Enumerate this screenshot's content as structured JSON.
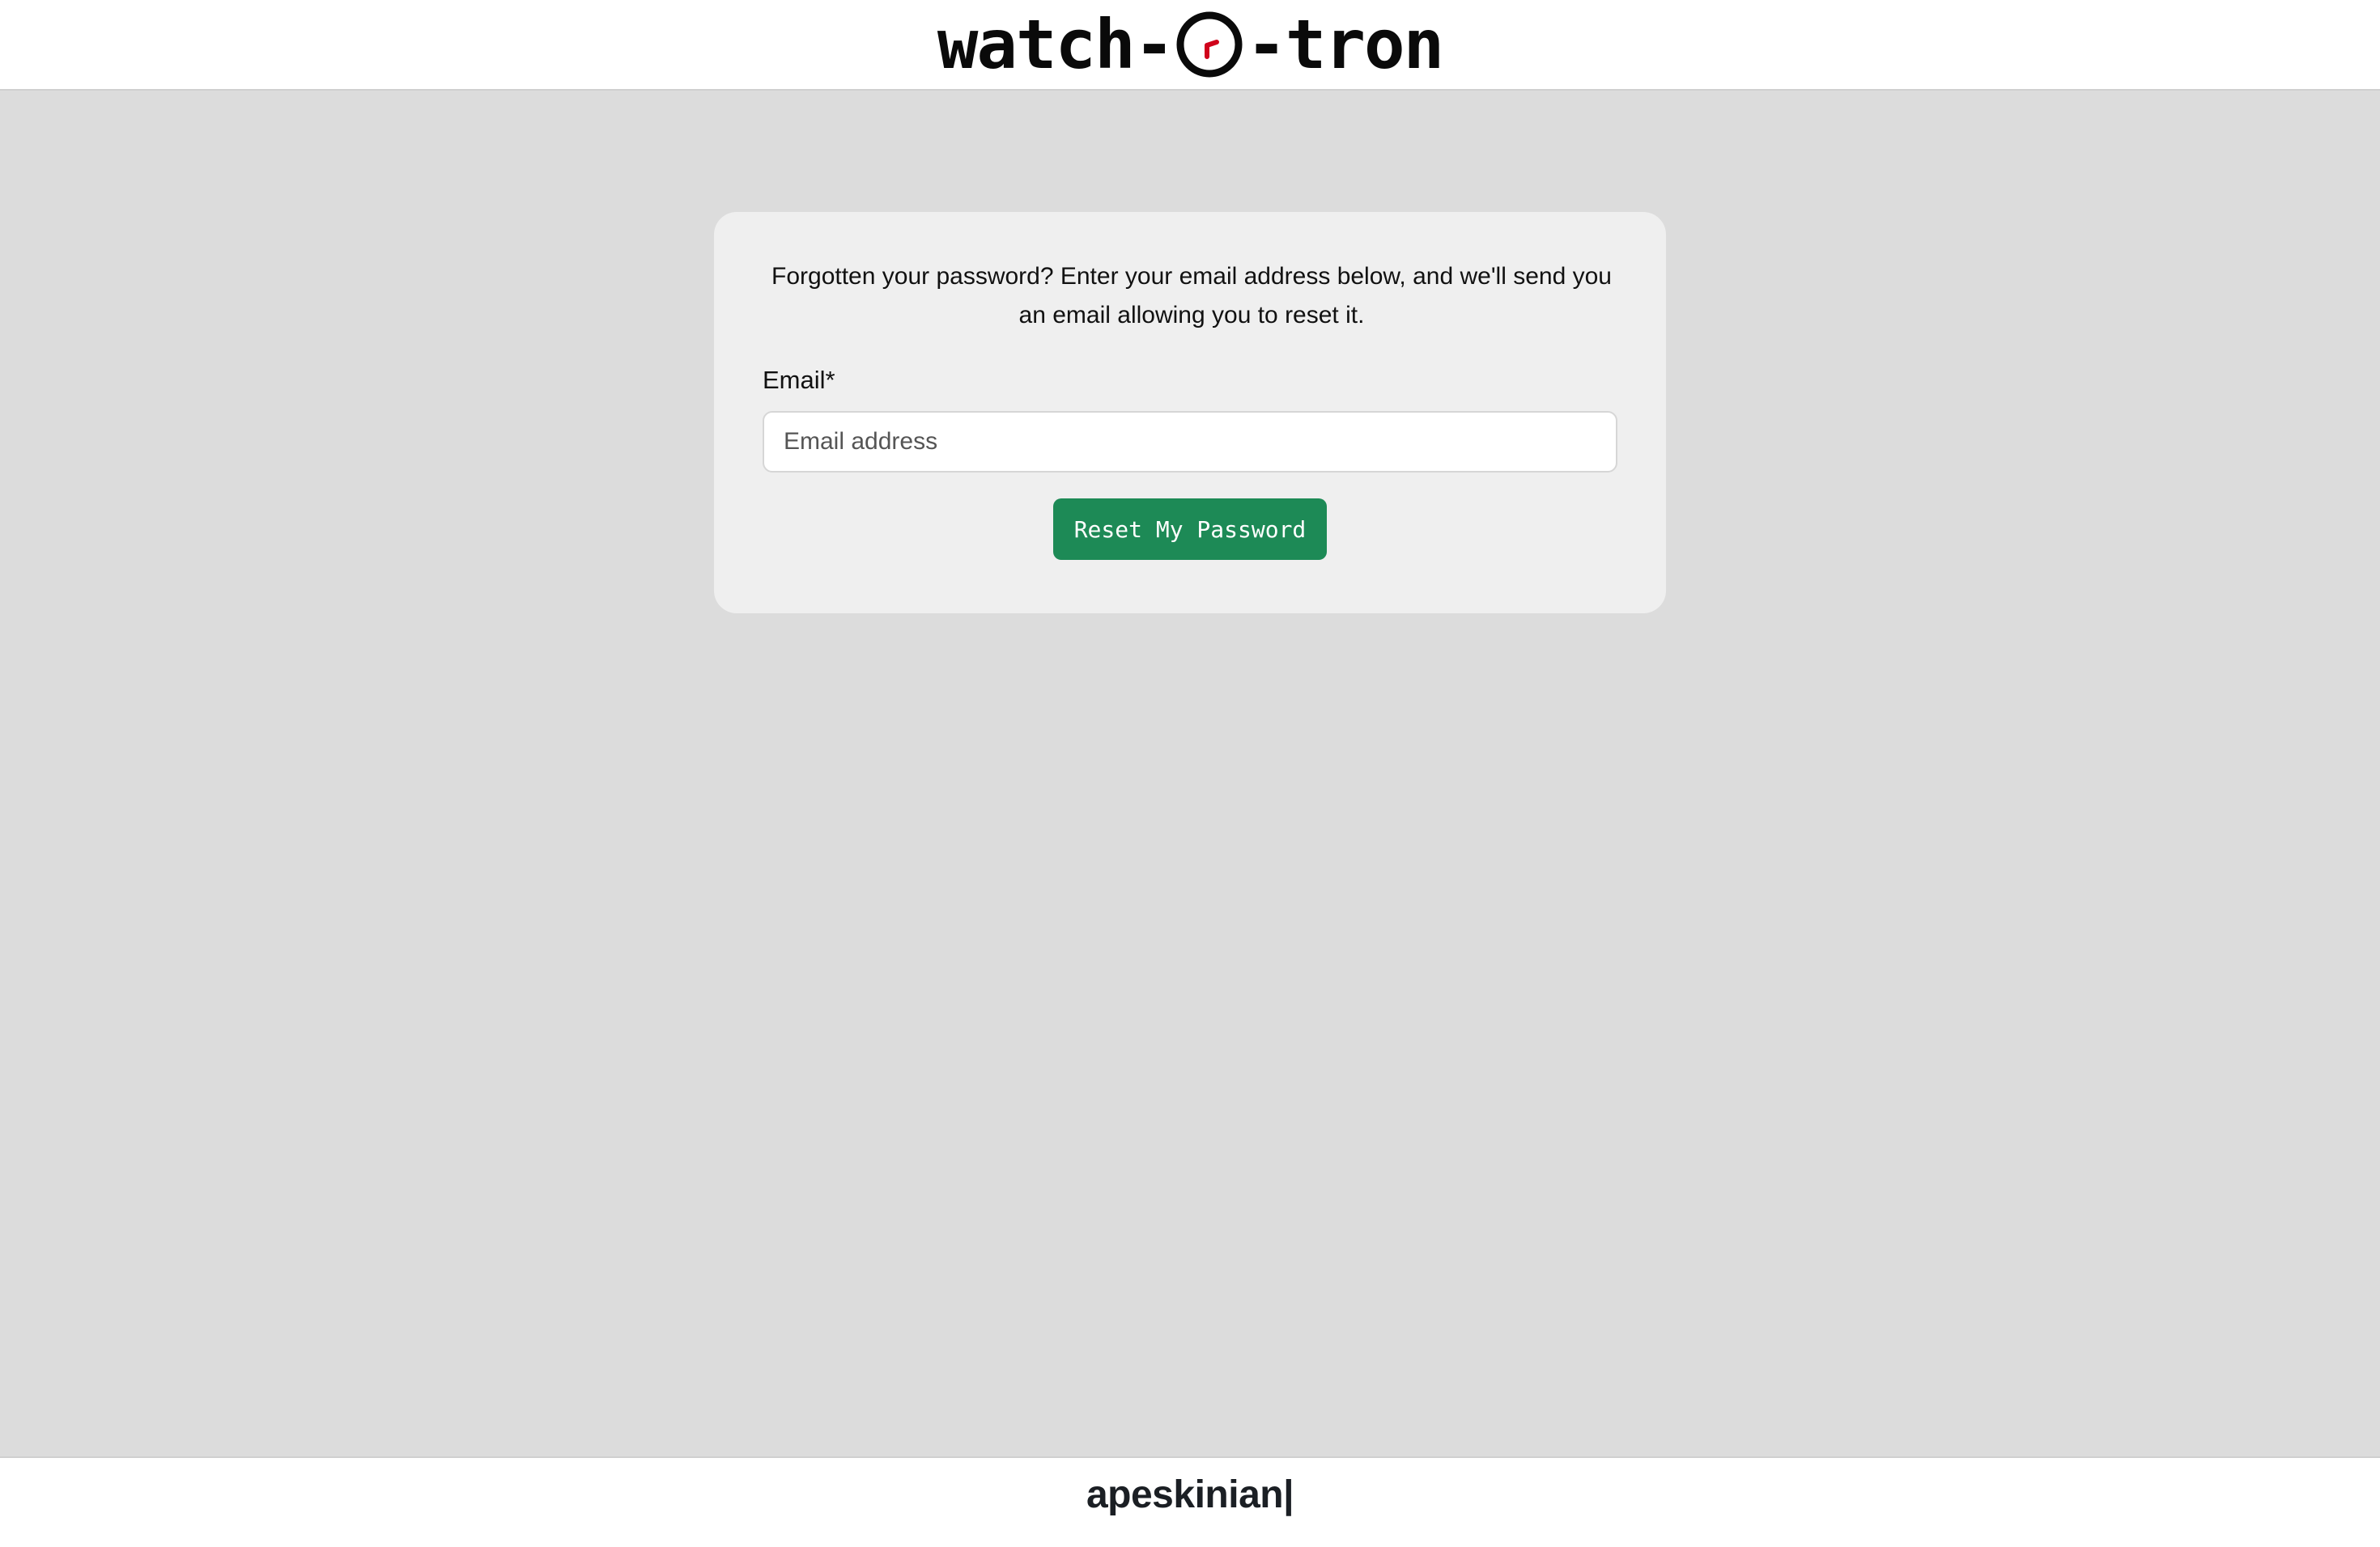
{
  "header": {
    "logo": {
      "left_text": "watch-",
      "right_text": "-tron",
      "icon": "clock-icon",
      "hand_color": "#d0021b"
    }
  },
  "reset_form": {
    "intro_text": "Forgotten your password? Enter your email address below, and we'll send you an email allowing you to reset it.",
    "email_label": "Email*",
    "email_value": "",
    "email_placeholder": "Email address",
    "submit_label": "Reset My Password"
  },
  "footer": {
    "brand": "apeskinian|"
  },
  "colors": {
    "page_background": "#dcdcdc",
    "card_background": "#efefef",
    "button_background": "#1d8a56",
    "button_text": "#ffffff"
  }
}
